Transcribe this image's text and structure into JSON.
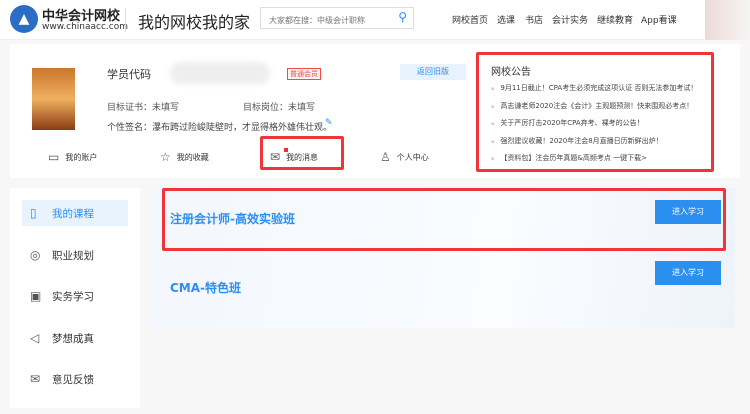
{
  "header": {
    "logo_title": "中华会计网校",
    "logo_url": "www.chinaacc.com",
    "page_title": "我的网校我的家",
    "search_placeholder": "大家都在搜：中级会计职称",
    "nav": [
      "网校首页",
      "选课",
      "书店",
      "会计实务",
      "继续教育",
      "App看课"
    ]
  },
  "profile": {
    "name_label": "学员代码",
    "member_badge": "普通会员",
    "old_version": "返回旧版",
    "target_cert": "目标证书：未填写",
    "target_post": "目标岗位：未填写",
    "signature": "个性签名：瀑布跨过险峻陡壁时，才显得格外雄伟壮观。",
    "tabs": [
      "我的账户",
      "我的收藏",
      "我的消息",
      "个人中心"
    ]
  },
  "notice": {
    "title": "网校公告",
    "items": [
      "9月11日截止！CPA考生必须完成这项认证 否则无法参加考试！",
      "高志谦老师2020注会《会计》主观题预测！快来围观必考点！",
      "关于严厉打击2020年CPA弃考、裸考的公告！",
      "强烈建议收藏！2020年注会8月直播日历新鲜出炉！",
      "【资料包】注会历年真题&高频考点 一键下载>"
    ]
  },
  "sidebar": [
    "我的课程",
    "职业规划",
    "实务学习",
    "梦想成真",
    "意见反馈"
  ],
  "courses": [
    {
      "title": "注册会计师-高效实验班",
      "button": "进入学习"
    },
    {
      "title": "CMA-特色班",
      "button": "进入学习"
    }
  ],
  "colors": {
    "accent": "#2b8ff0",
    "highlight": "#f0353a"
  }
}
